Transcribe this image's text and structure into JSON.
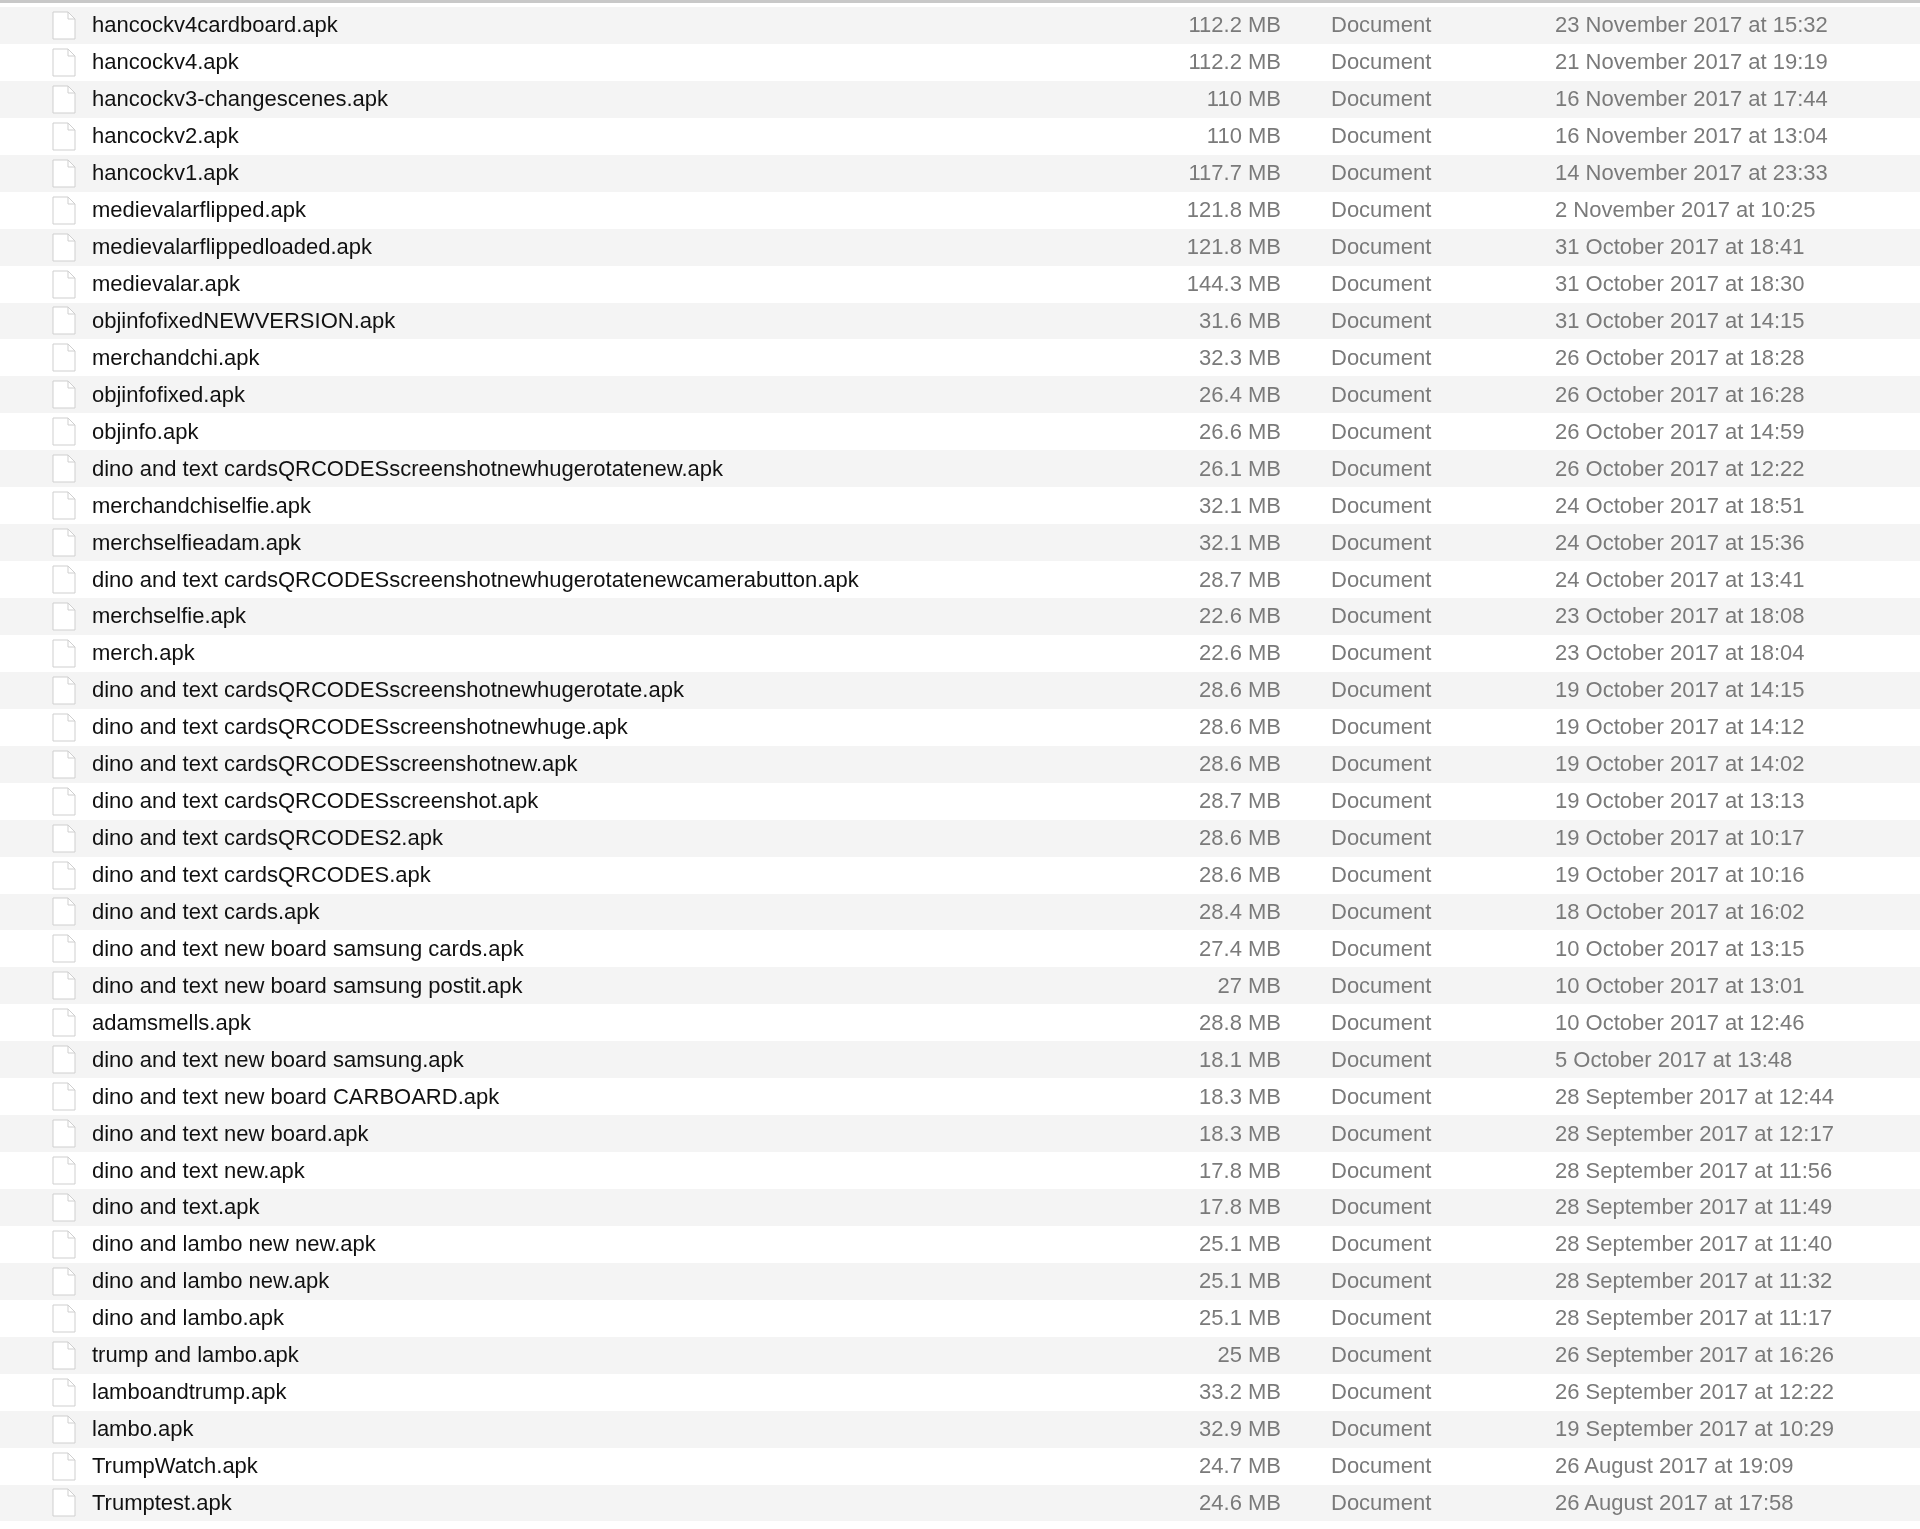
{
  "files": [
    {
      "name": "hancockv4cardboard.apk",
      "size": "112.2 MB",
      "kind": "Document",
      "modified": "23 November 2017 at 15:32"
    },
    {
      "name": "hancockv4.apk",
      "size": "112.2 MB",
      "kind": "Document",
      "modified": "21 November 2017 at 19:19"
    },
    {
      "name": "hancockv3-changescenes.apk",
      "size": "110 MB",
      "kind": "Document",
      "modified": "16 November 2017 at 17:44"
    },
    {
      "name": "hancockv2.apk",
      "size": "110 MB",
      "kind": "Document",
      "modified": "16 November 2017 at 13:04"
    },
    {
      "name": "hancockv1.apk",
      "size": "117.7 MB",
      "kind": "Document",
      "modified": "14 November 2017 at 23:33"
    },
    {
      "name": "medievalarflipped.apk",
      "size": "121.8 MB",
      "kind": "Document",
      "modified": "2 November 2017 at 10:25"
    },
    {
      "name": "medievalarflippedloaded.apk",
      "size": "121.8 MB",
      "kind": "Document",
      "modified": "31 October 2017 at 18:41"
    },
    {
      "name": "medievalar.apk",
      "size": "144.3 MB",
      "kind": "Document",
      "modified": "31 October 2017 at 18:30"
    },
    {
      "name": "objinfofixedNEWVERSION.apk",
      "size": "31.6 MB",
      "kind": "Document",
      "modified": "31 October 2017 at 14:15"
    },
    {
      "name": "merchandchi.apk",
      "size": "32.3 MB",
      "kind": "Document",
      "modified": "26 October 2017 at 18:28"
    },
    {
      "name": "objinfofixed.apk",
      "size": "26.4 MB",
      "kind": "Document",
      "modified": "26 October 2017 at 16:28"
    },
    {
      "name": "objinfo.apk",
      "size": "26.6 MB",
      "kind": "Document",
      "modified": "26 October 2017 at 14:59"
    },
    {
      "name": "dino and text cardsQRCODESscreenshotnewhugerotatenew.apk",
      "size": "26.1 MB",
      "kind": "Document",
      "modified": "26 October 2017 at 12:22"
    },
    {
      "name": "merchandchiselfie.apk",
      "size": "32.1 MB",
      "kind": "Document",
      "modified": "24 October 2017 at 18:51"
    },
    {
      "name": "merchselfieadam.apk",
      "size": "32.1 MB",
      "kind": "Document",
      "modified": "24 October 2017 at 15:36"
    },
    {
      "name": "dino and text cardsQRCODESscreenshotnewhugerotatenewcamerabutton.apk",
      "size": "28.7 MB",
      "kind": "Document",
      "modified": "24 October 2017 at 13:41"
    },
    {
      "name": "merchselfie.apk",
      "size": "22.6 MB",
      "kind": "Document",
      "modified": "23 October 2017 at 18:08"
    },
    {
      "name": "merch.apk",
      "size": "22.6 MB",
      "kind": "Document",
      "modified": "23 October 2017 at 18:04"
    },
    {
      "name": "dino and text cardsQRCODESscreenshotnewhugerotate.apk",
      "size": "28.6 MB",
      "kind": "Document",
      "modified": "19 October 2017 at 14:15"
    },
    {
      "name": "dino and text cardsQRCODESscreenshotnewhuge.apk",
      "size": "28.6 MB",
      "kind": "Document",
      "modified": "19 October 2017 at 14:12"
    },
    {
      "name": "dino and text cardsQRCODESscreenshotnew.apk",
      "size": "28.6 MB",
      "kind": "Document",
      "modified": "19 October 2017 at 14:02"
    },
    {
      "name": "dino and text cardsQRCODESscreenshot.apk",
      "size": "28.7 MB",
      "kind": "Document",
      "modified": "19 October 2017 at 13:13"
    },
    {
      "name": "dino and text cardsQRCODES2.apk",
      "size": "28.6 MB",
      "kind": "Document",
      "modified": "19 October 2017 at 10:17"
    },
    {
      "name": "dino and text cardsQRCODES.apk",
      "size": "28.6 MB",
      "kind": "Document",
      "modified": "19 October 2017 at 10:16"
    },
    {
      "name": "dino and text cards.apk",
      "size": "28.4 MB",
      "kind": "Document",
      "modified": "18 October 2017 at 16:02"
    },
    {
      "name": "dino and text new board samsung cards.apk",
      "size": "27.4 MB",
      "kind": "Document",
      "modified": "10 October 2017 at 13:15"
    },
    {
      "name": "dino and text new board samsung postit.apk",
      "size": "27 MB",
      "kind": "Document",
      "modified": "10 October 2017 at 13:01"
    },
    {
      "name": "adamsmells.apk",
      "size": "28.8 MB",
      "kind": "Document",
      "modified": "10 October 2017 at 12:46"
    },
    {
      "name": "dino and text new board samsung.apk",
      "size": "18.1 MB",
      "kind": "Document",
      "modified": "5 October 2017 at 13:48"
    },
    {
      "name": "dino and text new board CARBOARD.apk",
      "size": "18.3 MB",
      "kind": "Document",
      "modified": "28 September 2017 at 12:44"
    },
    {
      "name": "dino and text new board.apk",
      "size": "18.3 MB",
      "kind": "Document",
      "modified": "28 September 2017 at 12:17"
    },
    {
      "name": "dino and text new.apk",
      "size": "17.8 MB",
      "kind": "Document",
      "modified": "28 September 2017 at 11:56"
    },
    {
      "name": "dino and text.apk",
      "size": "17.8 MB",
      "kind": "Document",
      "modified": "28 September 2017 at 11:49"
    },
    {
      "name": "dino and lambo new new.apk",
      "size": "25.1 MB",
      "kind": "Document",
      "modified": "28 September 2017 at 11:40"
    },
    {
      "name": "dino and lambo new.apk",
      "size": "25.1 MB",
      "kind": "Document",
      "modified": "28 September 2017 at 11:32"
    },
    {
      "name": "dino and lambo.apk",
      "size": "25.1 MB",
      "kind": "Document",
      "modified": "28 September 2017 at 11:17"
    },
    {
      "name": "trump and lambo.apk",
      "size": "25 MB",
      "kind": "Document",
      "modified": "26 September 2017 at 16:26"
    },
    {
      "name": "lamboandtrump.apk",
      "size": "33.2 MB",
      "kind": "Document",
      "modified": "26 September 2017 at 12:22"
    },
    {
      "name": "lambo.apk",
      "size": "32.9 MB",
      "kind": "Document",
      "modified": "19 September 2017 at 10:29"
    },
    {
      "name": "TrumpWatch.apk",
      "size": "24.7 MB",
      "kind": "Document",
      "modified": "26 August 2017 at 19:09"
    },
    {
      "name": "Trumptest.apk",
      "size": "24.6 MB",
      "kind": "Document",
      "modified": "26 August 2017 at 17:58"
    }
  ]
}
